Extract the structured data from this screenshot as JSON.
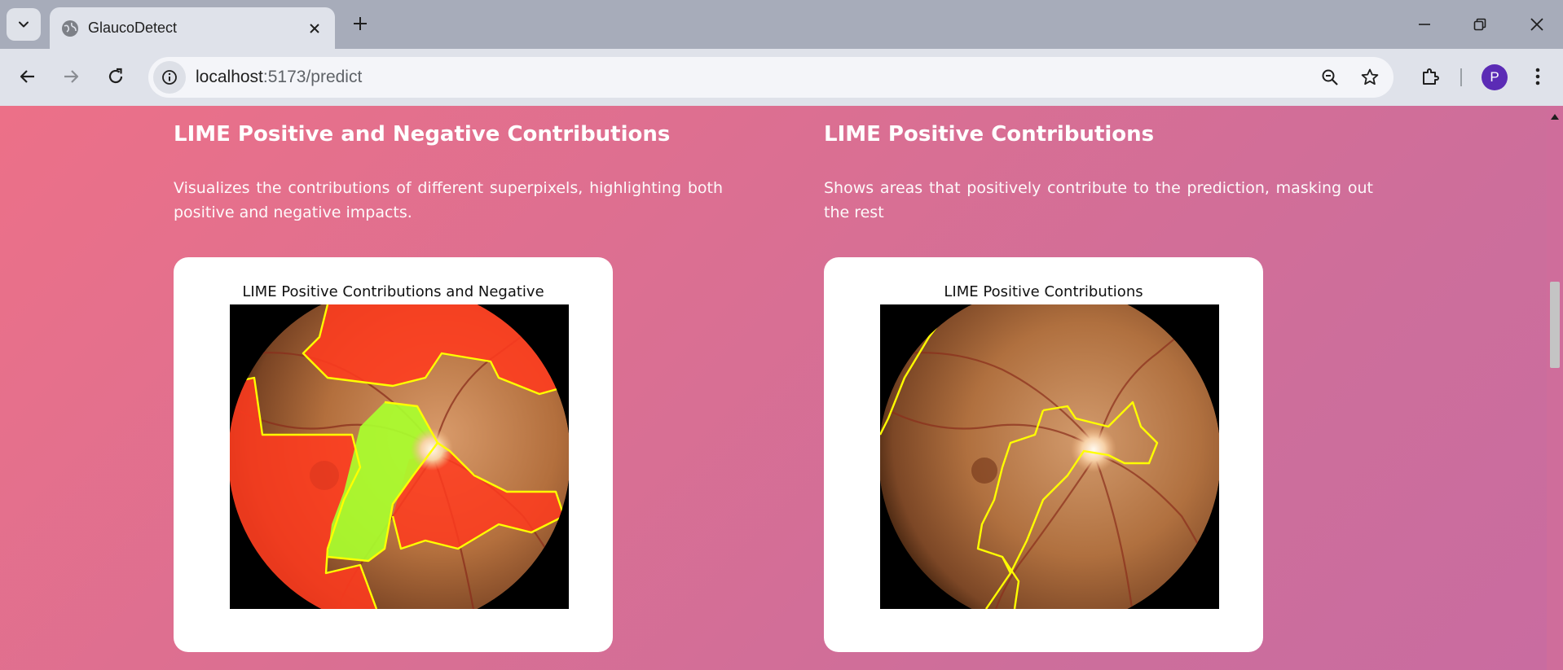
{
  "browser": {
    "tab_title": "GlaucoDetect",
    "url_host": "localhost",
    "url_path": ":5173/predict",
    "profile_initial": "P"
  },
  "sections": [
    {
      "heading": "LIME Positive and Negative Contributions",
      "description": "Visualizes the contributions of different superpixels, highlighting both positive and negative impacts.",
      "figure_title": "LIME Positive Contributions and Negative"
    },
    {
      "heading": "LIME Positive Contributions",
      "description": "Shows areas that positively contribute to the prediction, masking out the rest",
      "figure_title": "LIME Positive Contributions"
    }
  ],
  "colors": {
    "page_gradient_start": "#ec7088",
    "page_gradient_end": "#c96ca0",
    "boundary": "#ffff00",
    "negative_overlay": "#ff3b22",
    "positive_overlay": "#b5ff30"
  }
}
